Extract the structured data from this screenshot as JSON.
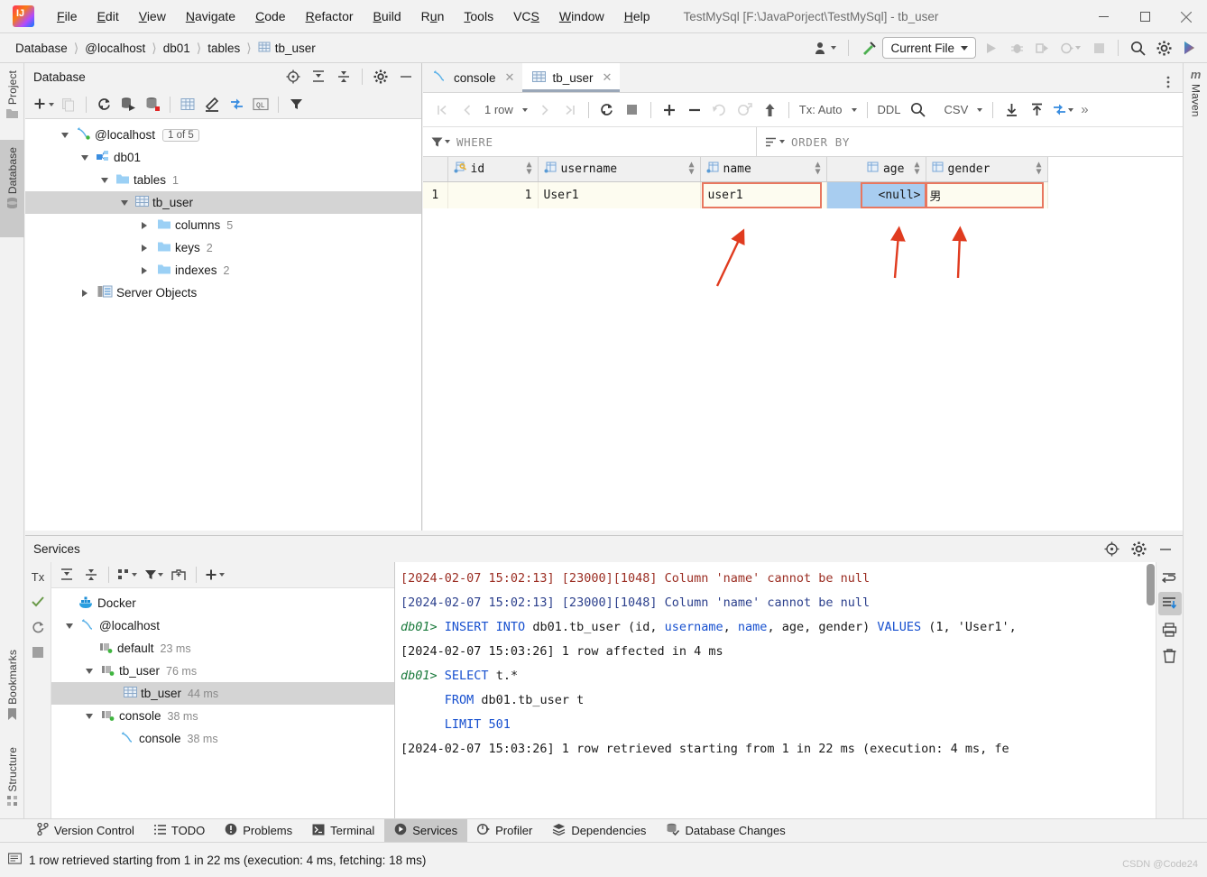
{
  "window": {
    "title": "TestMySql [F:\\JavaPorject\\TestMySql] - tb_user",
    "minimize": "—",
    "maximize": "☐",
    "close": "✕",
    "logo_text": "IJ"
  },
  "menubar": [
    {
      "label": "File",
      "mnemonic": "F"
    },
    {
      "label": "Edit",
      "mnemonic": "E"
    },
    {
      "label": "View",
      "mnemonic": "V"
    },
    {
      "label": "Navigate",
      "mnemonic": "N"
    },
    {
      "label": "Code",
      "mnemonic": "C"
    },
    {
      "label": "Refactor",
      "mnemonic": "R"
    },
    {
      "label": "Build",
      "mnemonic": "B"
    },
    {
      "label": "Run",
      "mnemonic": "u"
    },
    {
      "label": "Tools",
      "mnemonic": "T"
    },
    {
      "label": "VCS",
      "mnemonic": "S"
    },
    {
      "label": "Window",
      "mnemonic": "W"
    },
    {
      "label": "Help",
      "mnemonic": "H"
    }
  ],
  "breadcrumb": [
    "Database",
    "@localhost",
    "db01",
    "tables",
    "tb_user"
  ],
  "toolbar": {
    "run_config": "Current File",
    "icons": [
      "account-icon",
      "build-hammer-icon",
      "run-icon",
      "debug-icon",
      "run-with-coverage-icon",
      "profile-icon",
      "stop-icon",
      "search-everywhere-icon",
      "settings-icon",
      "updates-icon"
    ]
  },
  "left_stripe": [
    {
      "label": "Project",
      "icon": "project-folder-icon",
      "active": false
    },
    {
      "label": "Database",
      "icon": "database-icon",
      "active": true
    }
  ],
  "left_stripe_bottom": [
    {
      "label": "Bookmarks",
      "icon": "bookmark-icon"
    },
    {
      "label": "Structure",
      "icon": "structure-icon"
    }
  ],
  "right_stripe": [
    {
      "label": "Maven",
      "icon": "maven-icon"
    }
  ],
  "database_panel": {
    "title": "Database",
    "header_icons": [
      "locate-icon",
      "expand-all-icon",
      "collapse-all-icon",
      "settings-icon",
      "hide-icon"
    ],
    "toolbar_icons": [
      "add-icon",
      "duplicate-icon",
      "refresh-icon",
      "run-sql-icon",
      "db-modify-icon",
      "table-editor-icon",
      "edit-icon",
      "sync-icon",
      "qlconsole-icon",
      "filter-icon"
    ],
    "tree": [
      {
        "label": "@localhost",
        "icon": "mysql-connection-icon",
        "badge": "1 of 5",
        "indent": 0,
        "expanded": true,
        "selected": false
      },
      {
        "label": "db01",
        "icon": "schema-icon",
        "count": "",
        "indent": 1,
        "expanded": true,
        "selected": false
      },
      {
        "label": "tables",
        "icon": "folder-icon",
        "count": "1",
        "indent": 2,
        "expanded": true,
        "selected": false
      },
      {
        "label": "tb_user",
        "icon": "table-icon",
        "count": "",
        "indent": 3,
        "expanded": true,
        "selected": true
      },
      {
        "label": "columns",
        "icon": "folder-icon",
        "count": "5",
        "indent": 4,
        "expanded": false,
        "selected": false
      },
      {
        "label": "keys",
        "icon": "folder-icon",
        "count": "2",
        "indent": 4,
        "expanded": false,
        "selected": false
      },
      {
        "label": "indexes",
        "icon": "folder-icon",
        "count": "2",
        "indent": 4,
        "expanded": false,
        "selected": false
      },
      {
        "label": "Server Objects",
        "icon": "server-objects-icon",
        "count": "",
        "indent": 1,
        "expanded": false,
        "selected": false
      }
    ]
  },
  "editor": {
    "tabs": [
      {
        "label": "console",
        "icon": "mysql-console-icon",
        "active": false
      },
      {
        "label": "tb_user",
        "icon": "table-icon",
        "active": true
      }
    ],
    "grid_toolbar": {
      "first_label": "|‹",
      "row_count": "1 row",
      "tx_label": "Tx: Auto",
      "ddl_label": "DDL",
      "csv_label": "CSV",
      "overflow": "»"
    },
    "filters": {
      "where_label": "WHERE",
      "orderby_label": "ORDER BY"
    },
    "grid": {
      "columns": [
        {
          "name": "id",
          "icon": "primary-key-column-icon",
          "sortable": true
        },
        {
          "name": "username",
          "icon": "column-icon",
          "sortable": true
        },
        {
          "name": "name",
          "icon": "column-icon",
          "sortable": true
        },
        {
          "name": "age",
          "icon": "column-icon",
          "sortable": true
        },
        {
          "name": "gender",
          "icon": "column-icon",
          "sortable": true
        }
      ],
      "rows": [
        {
          "number": "1",
          "cells": [
            {
              "value": "1",
              "align": "right",
              "highlight": false,
              "selected": false
            },
            {
              "value": "User1",
              "align": "left",
              "highlight": false,
              "selected": false
            },
            {
              "value": "user1",
              "align": "left",
              "highlight": true,
              "selected": false
            },
            {
              "value": "<null>",
              "align": "right",
              "highlight": true,
              "selected": true
            },
            {
              "value": "男",
              "align": "left",
              "highlight": true,
              "selected": false
            }
          ]
        }
      ]
    }
  },
  "services": {
    "title": "Services",
    "header_icons": [
      "locate-icon",
      "settings-icon",
      "hide-icon"
    ],
    "left_icons": [
      "tx-icon",
      "check-icon",
      "rerun-icon",
      "stop-icon"
    ],
    "toolbar_icons": [
      "expand-all-icon",
      "collapse-all-icon",
      "group-icon",
      "filter-icon",
      "add-tab-icon",
      "add-icon"
    ],
    "tree": [
      {
        "label": "Docker",
        "icon": "docker-icon",
        "time": "",
        "indent": 0,
        "expanded": null,
        "selected": false
      },
      {
        "label": "@localhost",
        "icon": "mysql-connection-icon",
        "time": "",
        "indent": 0,
        "expanded": true,
        "selected": false
      },
      {
        "label": "default",
        "icon": "session-icon",
        "time": "23 ms",
        "indent": 1,
        "expanded": null,
        "selected": false
      },
      {
        "label": "tb_user",
        "icon": "session-icon",
        "time": "76 ms",
        "indent": 1,
        "expanded": true,
        "selected": false
      },
      {
        "label": "tb_user",
        "icon": "table-icon",
        "time": "44 ms",
        "indent": 2,
        "expanded": null,
        "selected": true
      },
      {
        "label": "console",
        "icon": "session-icon",
        "time": "38 ms",
        "indent": 1,
        "expanded": true,
        "selected": false
      },
      {
        "label": "console",
        "icon": "mysql-console-icon",
        "time": "38 ms",
        "indent": 2,
        "expanded": null,
        "selected": false
      }
    ],
    "console_lines": [
      [
        {
          "t": "[2024-02-07 15:02:13] [23000][1048] Column 'name' cannot be null",
          "c": "cl-red"
        }
      ],
      [
        {
          "t": "[2024-02-07 15:02:13] [23000][1048] Column 'name' cannot be null",
          "c": "cl-blue"
        }
      ],
      [
        {
          "t": "db01> ",
          "c": "cl-prompt"
        },
        {
          "t": "INSERT INTO",
          "c": "cl-kw"
        },
        {
          "t": " db01.tb_user (id, ",
          "c": "cl-plain"
        },
        {
          "t": "username",
          "c": "cl-kw"
        },
        {
          "t": ", ",
          "c": "cl-plain"
        },
        {
          "t": "name",
          "c": "cl-kw"
        },
        {
          "t": ", age, gender) ",
          "c": "cl-plain"
        },
        {
          "t": "VALUES",
          "c": "cl-kw"
        },
        {
          "t": " (1, 'User1',",
          "c": "cl-plain"
        }
      ],
      [
        {
          "t": "[2024-02-07 15:03:26] 1 row affected in 4 ms",
          "c": "cl-plain"
        }
      ],
      [
        {
          "t": "db01> ",
          "c": "cl-prompt"
        },
        {
          "t": "SELECT",
          "c": "cl-kw"
        },
        {
          "t": " t.*",
          "c": "cl-plain"
        }
      ],
      [
        {
          "t": "      ",
          "c": "cl-plain"
        },
        {
          "t": "FROM",
          "c": "cl-kw"
        },
        {
          "t": " db01.tb_user t",
          "c": "cl-plain"
        }
      ],
      [
        {
          "t": "      ",
          "c": "cl-plain"
        },
        {
          "t": "LIMIT",
          "c": "cl-kw"
        },
        {
          "t": " 501",
          "c": "cl-num"
        }
      ],
      [
        {
          "t": "[2024-02-07 15:03:26] 1 row retrieved starting from 1 in 22 ms (execution: 4 ms, fe",
          "c": "cl-plain"
        }
      ]
    ],
    "right_icons": [
      "soft-wrap-icon",
      "scroll-to-end-icon",
      "print-icon",
      "delete-icon"
    ]
  },
  "tool_window_tabs": [
    {
      "label": "Version Control",
      "icon": "branch-icon",
      "active": false
    },
    {
      "label": "TODO",
      "icon": "todo-icon",
      "active": false
    },
    {
      "label": "Problems",
      "icon": "problems-icon",
      "active": false
    },
    {
      "label": "Terminal",
      "icon": "terminal-icon",
      "active": false
    },
    {
      "label": "Services",
      "icon": "services-icon",
      "active": true
    },
    {
      "label": "Profiler",
      "icon": "profiler-icon",
      "active": false
    },
    {
      "label": "Dependencies",
      "icon": "dependencies-icon",
      "active": false
    },
    {
      "label": "Database Changes",
      "icon": "db-changes-icon",
      "active": false
    }
  ],
  "statusbar": {
    "message": "1 row retrieved starting from 1 in 22 ms (execution: 4 ms, fetching: 18 ms)",
    "watermark": "CSDN @Code24"
  },
  "colors": {
    "accent_blue": "#3b8ee0",
    "highlight_red": "#e8775f",
    "selection_blue": "#a8cdf0",
    "grid_row_bg": "#fdfcf0",
    "error_red": "#9b2d22",
    "keyword_blue": "#1750cf",
    "prompt_green": "#1a7a3c"
  }
}
